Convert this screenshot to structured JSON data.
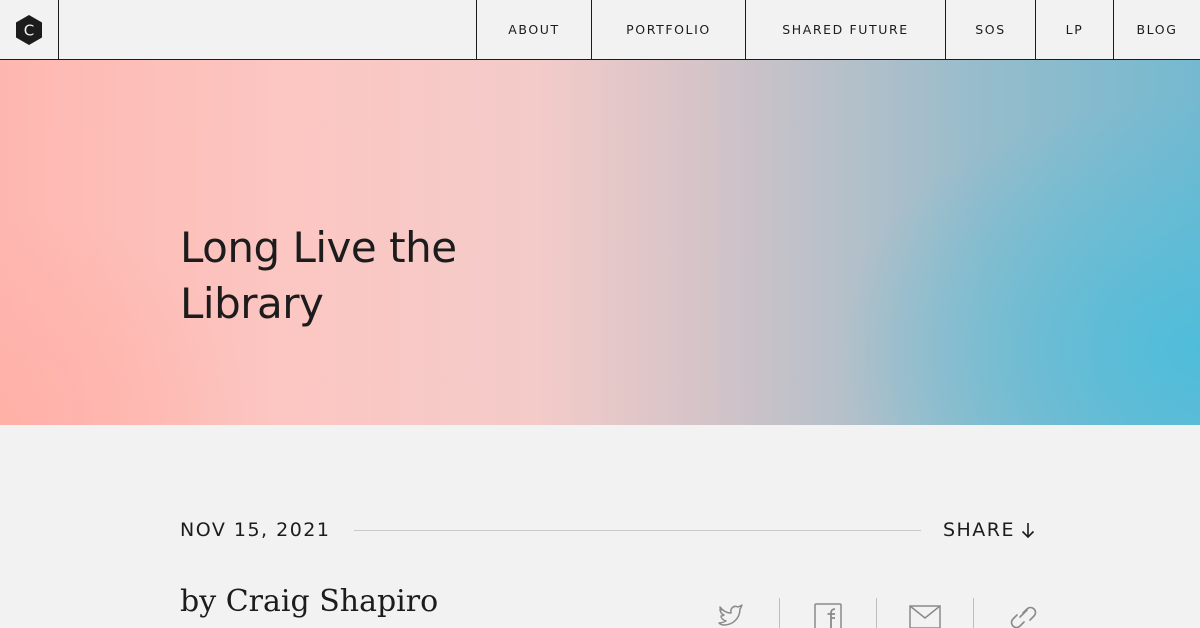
{
  "nav": {
    "about": "ABOUT",
    "portfolio": "PORTFOLIO",
    "shared_future": "SHARED FUTURE",
    "sos": "SOS",
    "lp": "LP",
    "blog": "BLOG"
  },
  "logo": {
    "letter": "C",
    "icon": "hexagon-logo-icon"
  },
  "hero": {
    "title": "Long Live the Library",
    "gradient_colors": [
      "#feb7b0",
      "#b6c0c9",
      "#4fbedc"
    ]
  },
  "post": {
    "date": "NOV 15, 2021",
    "share_label": "SHARE",
    "byline": "by Craig Shapiro"
  },
  "share_icons": [
    "twitter-icon",
    "facebook-icon",
    "email-icon",
    "link-icon"
  ],
  "colors": {
    "text": "#1c1c1c",
    "background": "#f2f2f2",
    "icon_gray": "#8a8a8a"
  }
}
